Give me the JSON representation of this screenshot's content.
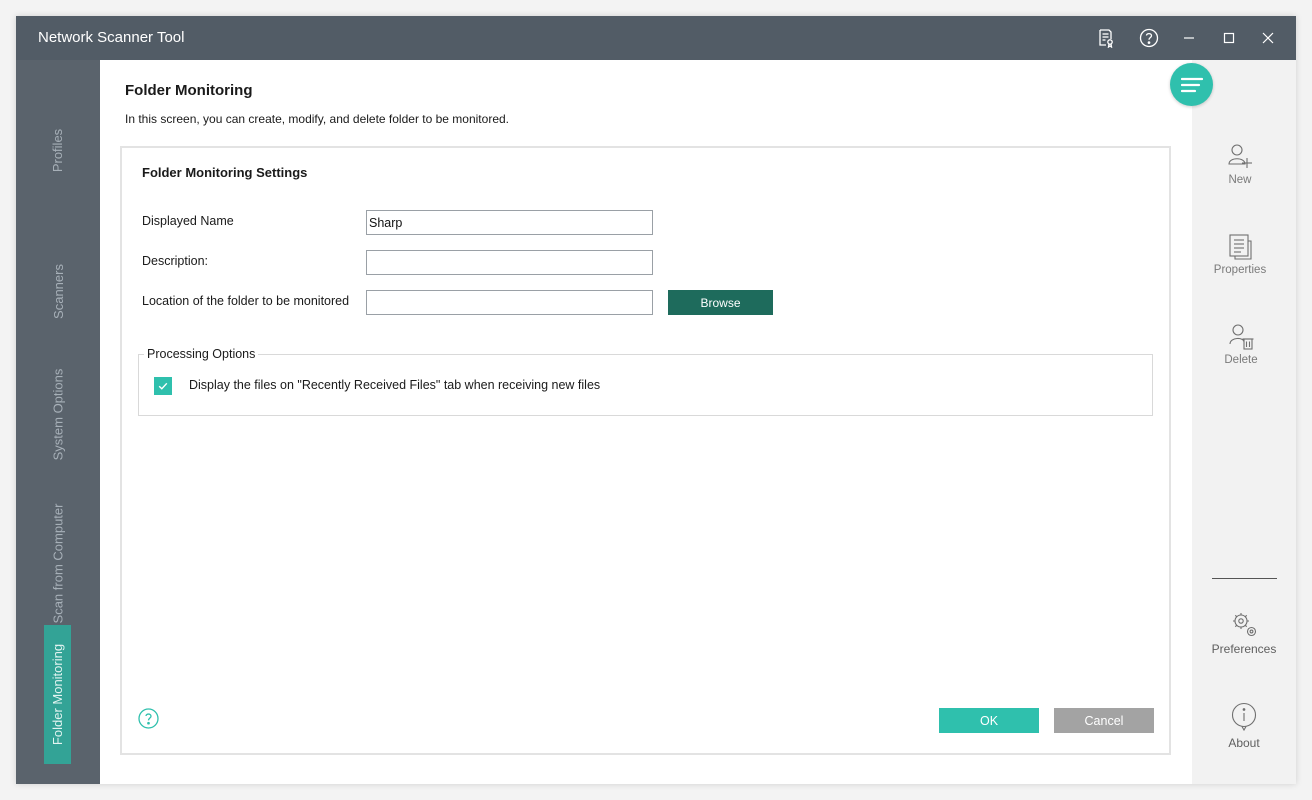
{
  "window": {
    "title": "Network Scanner Tool",
    "titlebar_icons": [
      "license-icon",
      "help-icon",
      "minimize-icon",
      "maximize-icon",
      "close-icon"
    ]
  },
  "leftnav": {
    "items": [
      {
        "label": "Profiles",
        "active": false
      },
      {
        "label": "Scanners",
        "active": false
      },
      {
        "label": "System Options",
        "active": false
      },
      {
        "label": "Scan from Computer",
        "active": false
      },
      {
        "label": "Folder Monitoring",
        "active": true
      }
    ]
  },
  "header": {
    "title": "Folder Monitoring",
    "description": "In this screen, you can create, modify, and delete folder to be monitored."
  },
  "settings": {
    "section_title": "Folder Monitoring Settings",
    "displayed_name_label": "Displayed Name",
    "displayed_name_value": "Sharp",
    "description_label": "Description:",
    "description_value": "",
    "location_label": "Location of the folder to be monitored",
    "location_value": "",
    "browse_label": "Browse"
  },
  "processing": {
    "legend": "Processing Options",
    "checkbox_label": "Display the files on \"Recently Received Files\" tab when receiving new files",
    "checked": true
  },
  "footer": {
    "ok_label": "OK",
    "cancel_label": "Cancel"
  },
  "rightbar": {
    "actions": [
      {
        "label": "New",
        "icon": "user-add-icon"
      },
      {
        "label": "Properties",
        "icon": "properties-icon"
      },
      {
        "label": "Delete",
        "icon": "user-delete-icon"
      }
    ],
    "preferences_label": "Preferences",
    "about_label": "About"
  },
  "colors": {
    "titlebar": "#525c66",
    "leftnav": "#5a636c",
    "accent": "#2fc0ad",
    "active_nav": "#33a396",
    "browse": "#1e6b5c",
    "cancel": "#a3a3a3"
  }
}
